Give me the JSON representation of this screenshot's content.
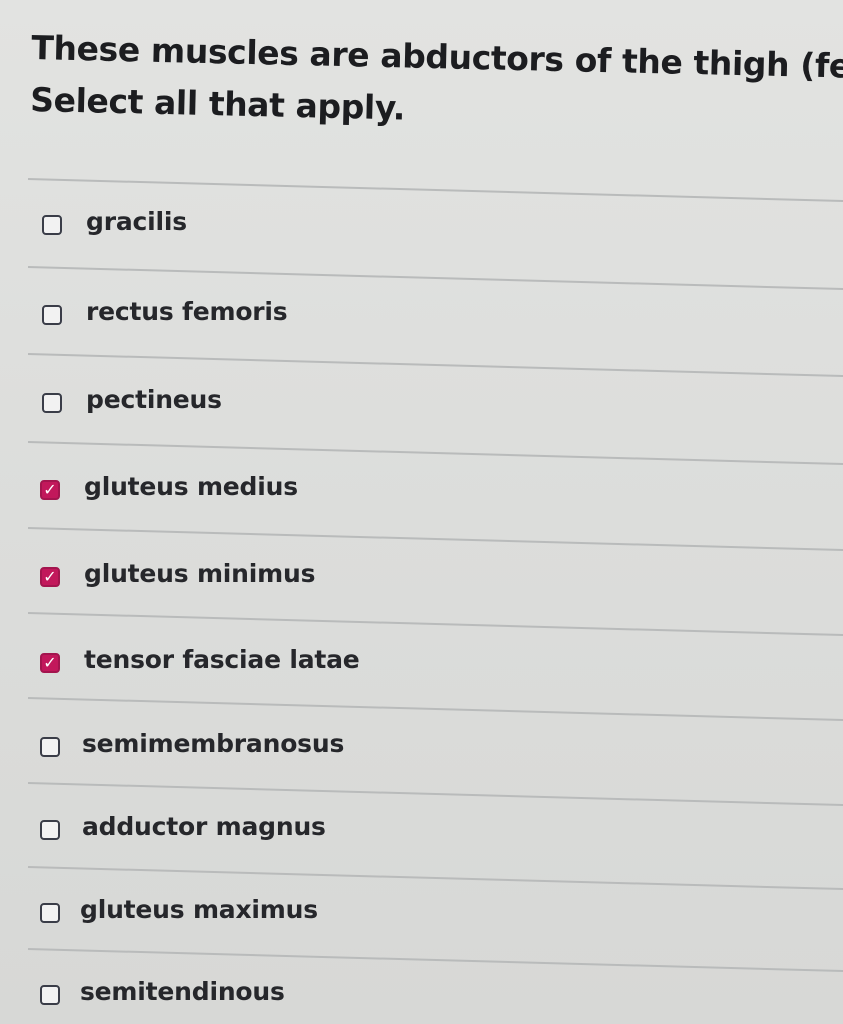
{
  "question": {
    "line1": "These muscles are abductors of the thigh (femur).",
    "line2": "Select all that apply."
  },
  "options": [
    {
      "label": "gracilis",
      "checked": false
    },
    {
      "label": "rectus femoris",
      "checked": false
    },
    {
      "label": "pectineus",
      "checked": false
    },
    {
      "label": "gluteus medius",
      "checked": true
    },
    {
      "label": "gluteus minimus",
      "checked": true
    },
    {
      "label": "tensor fasciae latae",
      "checked": true
    },
    {
      "label": "semimembranosus",
      "checked": false
    },
    {
      "label": "adductor magnus",
      "checked": false
    },
    {
      "label": "gluteus maximus",
      "checked": false
    },
    {
      "label": "semitendinous",
      "checked": false
    }
  ],
  "colors": {
    "checked_fill": "#c2185b",
    "checkbox_border": "#3a3d48"
  },
  "icons": {
    "checkbox": "checkbox-icon",
    "checkmark": "checkmark-icon"
  }
}
